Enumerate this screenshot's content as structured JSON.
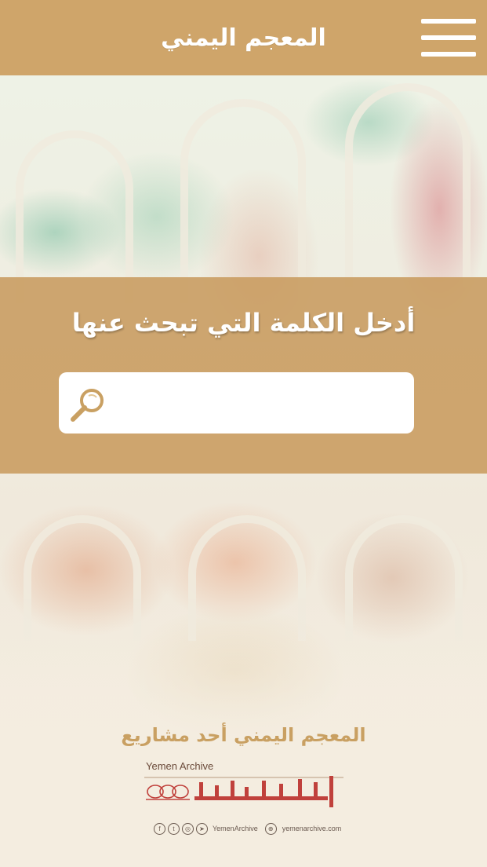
{
  "header": {
    "title": "المعجم اليمني",
    "menu_icon": "hamburger-menu-icon"
  },
  "search": {
    "heading": "أدخل الكلمة التي تبحث عنها",
    "value": "",
    "placeholder": "",
    "icon": "search-icon"
  },
  "footer": {
    "tagline": "المعجم اليمني أحد مشاريع",
    "logo_english": "Yemen Archive",
    "logo_arabic": "ارشيف اليمن",
    "social_handle": "YemenArchive",
    "website": "yemenarchive.com",
    "social_icons": [
      "facebook-icon",
      "twitter-icon",
      "instagram-icon",
      "telegram-icon"
    ]
  },
  "colors": {
    "header_bg": "#cfa56a",
    "band_bg": "#c89b5f",
    "footer_text": "#c9a062",
    "logo_red": "#c0413c"
  }
}
